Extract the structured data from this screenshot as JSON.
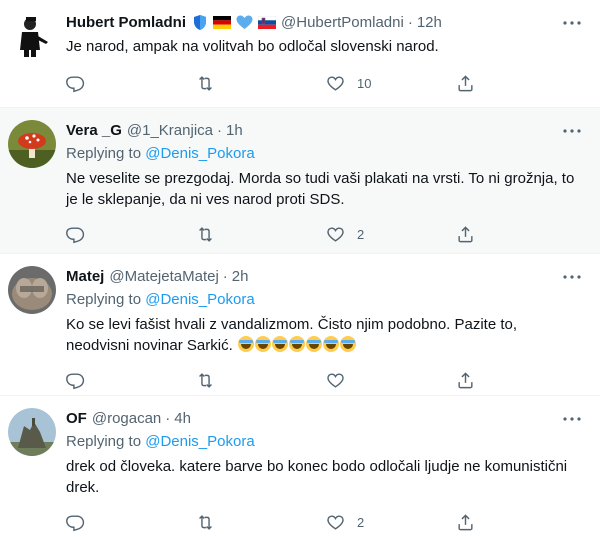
{
  "tweets": [
    {
      "name": "Hubert Pomladni",
      "handle": "@HubertPomladni",
      "separator": "·",
      "time": "12h",
      "replying_prefix": "",
      "replying_to": "",
      "text": "Je narod, ampak na volitvah bo odločal slovenski narod.",
      "reply_count": "",
      "retweet_count": "",
      "like_count": "10"
    },
    {
      "name": "Vera _G",
      "handle": "@1_Kranjica",
      "separator": "·",
      "time": "1h",
      "replying_prefix": "Replying to",
      "replying_to": "@Denis_Pokora",
      "text": "Ne veselite se prezgodaj. Morda so tudi vaši plakati na vrsti. To ni grožnja, to je le sklepanje, da ni ves narod proti SDS.",
      "reply_count": "",
      "retweet_count": "",
      "like_count": "2"
    },
    {
      "name": "Matej",
      "handle": "@MatejetaMatej",
      "separator": "·",
      "time": "2h",
      "replying_prefix": "Replying to",
      "replying_to": "@Denis_Pokora",
      "text": "Ko se levi fašist hvali z vandalizmom. Čisto njim podobno. Pazite to, neodvisni novinar Sarkić. ",
      "reply_count": "",
      "retweet_count": "",
      "like_count": ""
    },
    {
      "name": "OF",
      "handle": "@rogacan",
      "separator": "·",
      "time": "4h",
      "replying_prefix": "Replying to",
      "replying_to": "@Denis_Pokora",
      "text": "drek od človeka. katere barve bo konec bodo odločali ljudje ne komunistični drek.",
      "reply_count": "",
      "retweet_count": "",
      "like_count": "2"
    }
  ],
  "icons": {
    "reply": "reply-icon",
    "retweet": "retweet-icon",
    "like": "like-icon",
    "share": "share-icon",
    "more": "more-icon",
    "emoji": "rolling-laughing-emoji"
  },
  "colors": {
    "accent": "#1d9bf0",
    "secondary_text": "#536471",
    "highlight_bg": "#f7f9f9"
  }
}
